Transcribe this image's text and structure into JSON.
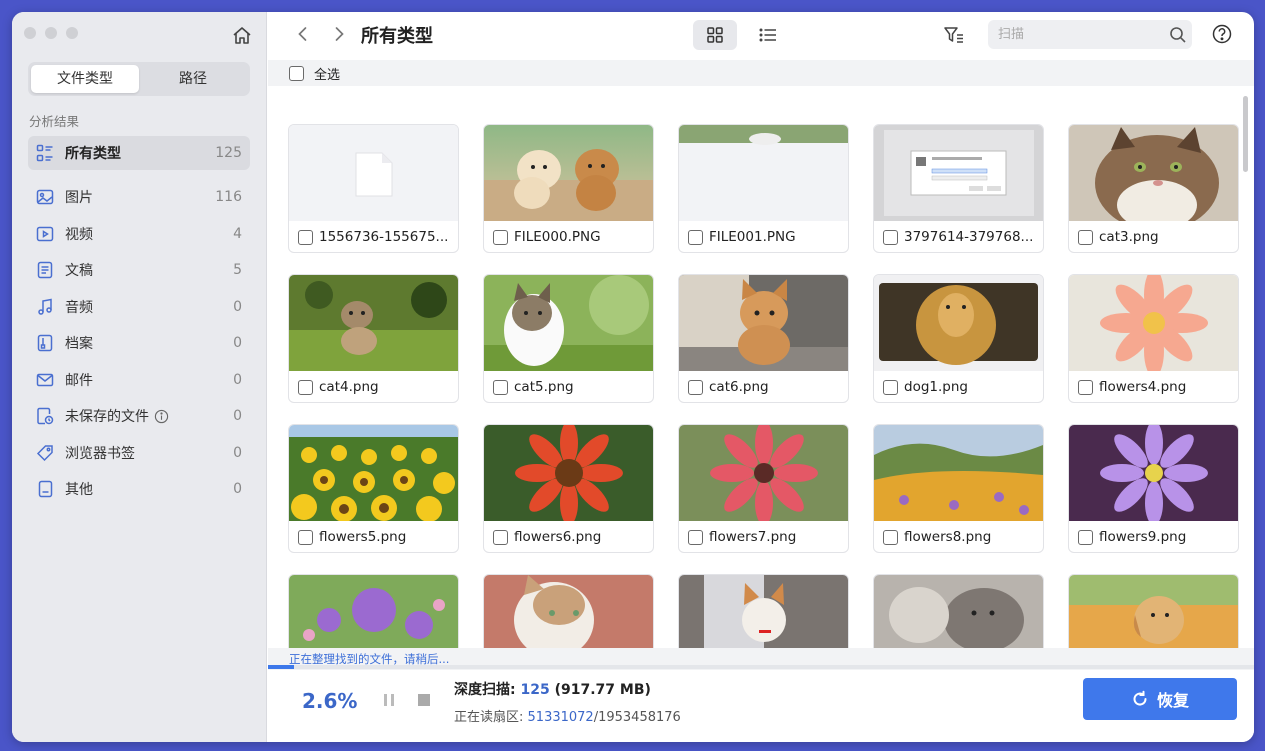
{
  "sidebar": {
    "tabs": [
      {
        "label": "文件类型"
      },
      {
        "label": "路径"
      }
    ],
    "section_label": "分析结果",
    "active": {
      "label": "所有类型",
      "count": "125",
      "icon": "all-types-icon"
    },
    "items": [
      {
        "label": "图片",
        "count": "116",
        "icon": "image-icon"
      },
      {
        "label": "视频",
        "count": "4",
        "icon": "video-icon"
      },
      {
        "label": "文稿",
        "count": "5",
        "icon": "document-icon"
      },
      {
        "label": "音频",
        "count": "0",
        "icon": "audio-icon"
      },
      {
        "label": "档案",
        "count": "0",
        "icon": "archive-icon"
      },
      {
        "label": "邮件",
        "count": "0",
        "icon": "mail-icon"
      },
      {
        "label": "未保存的文件",
        "count": "0",
        "icon": "unsaved-file-icon"
      },
      {
        "label": "浏览器书签",
        "count": "0",
        "icon": "bookmark-icon"
      },
      {
        "label": "其他",
        "count": "0",
        "icon": "other-icon"
      }
    ]
  },
  "toolbar": {
    "title": "所有类型",
    "search_placeholder": "扫描"
  },
  "select_all_label": "全选",
  "files": [
    {
      "name": "1556736-155675..."
    },
    {
      "name": "FILE000.PNG"
    },
    {
      "name": "FILE001.PNG"
    },
    {
      "name": "3797614-379768..."
    },
    {
      "name": "cat3.png"
    },
    {
      "name": "cat4.png"
    },
    {
      "name": "cat5.png"
    },
    {
      "name": "cat6.png"
    },
    {
      "name": "dog1.png"
    },
    {
      "name": "flowers4.png"
    },
    {
      "name": "flowers5.png"
    },
    {
      "name": "flowers6.png"
    },
    {
      "name": "flowers7.png"
    },
    {
      "name": "flowers8.png"
    },
    {
      "name": "flowers9.png"
    },
    {
      "name": ""
    },
    {
      "name": ""
    },
    {
      "name": ""
    },
    {
      "name": ""
    },
    {
      "name": ""
    }
  ],
  "status": {
    "organizing_text": "正在整理找到的文件，请稍后...",
    "progress_percent": "2.6%",
    "progress_fraction": 0.026,
    "scan_label": "深度扫描:",
    "scan_count": "125",
    "scan_size": "(917.77 MB)",
    "reading_label": "正在读扇区:",
    "sector_current": "51331072",
    "sector_total": "/1953458176"
  },
  "recover_button": "恢复",
  "colors": {
    "accent": "#3f78eb",
    "sidebar_bg": "#e9eaee",
    "frame": "#4a55c8"
  }
}
